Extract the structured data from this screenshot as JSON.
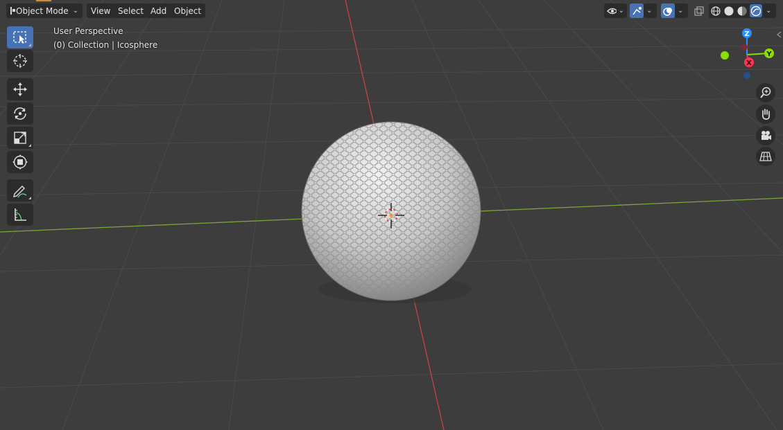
{
  "header": {
    "mode_label": "Object Mode",
    "menus": [
      "View",
      "Select",
      "Add",
      "Object"
    ]
  },
  "overlay": {
    "view_name": "User Perspective",
    "collection_text": "(0) Collection | Icosphere"
  },
  "toolbar": {
    "tools": [
      "select-box",
      "cursor",
      "move",
      "rotate",
      "scale",
      "transform",
      "annotate",
      "measure"
    ],
    "active_tool": "select-box"
  },
  "gizmo": {
    "axes": [
      "X",
      "Y",
      "Z"
    ],
    "colors": {
      "x": "#ff3352",
      "y": "#8bdc00",
      "z": "#2890ff"
    }
  },
  "navigation": [
    "zoom",
    "pan",
    "camera",
    "ortho-toggle"
  ],
  "scene": {
    "object_name": "Icosphere",
    "colors": {
      "grid_floor": "#3d3d3d",
      "x_axis_line": "#c8434a",
      "y_axis_line": "#7ea33b",
      "ball": "#d2d2d2"
    }
  }
}
